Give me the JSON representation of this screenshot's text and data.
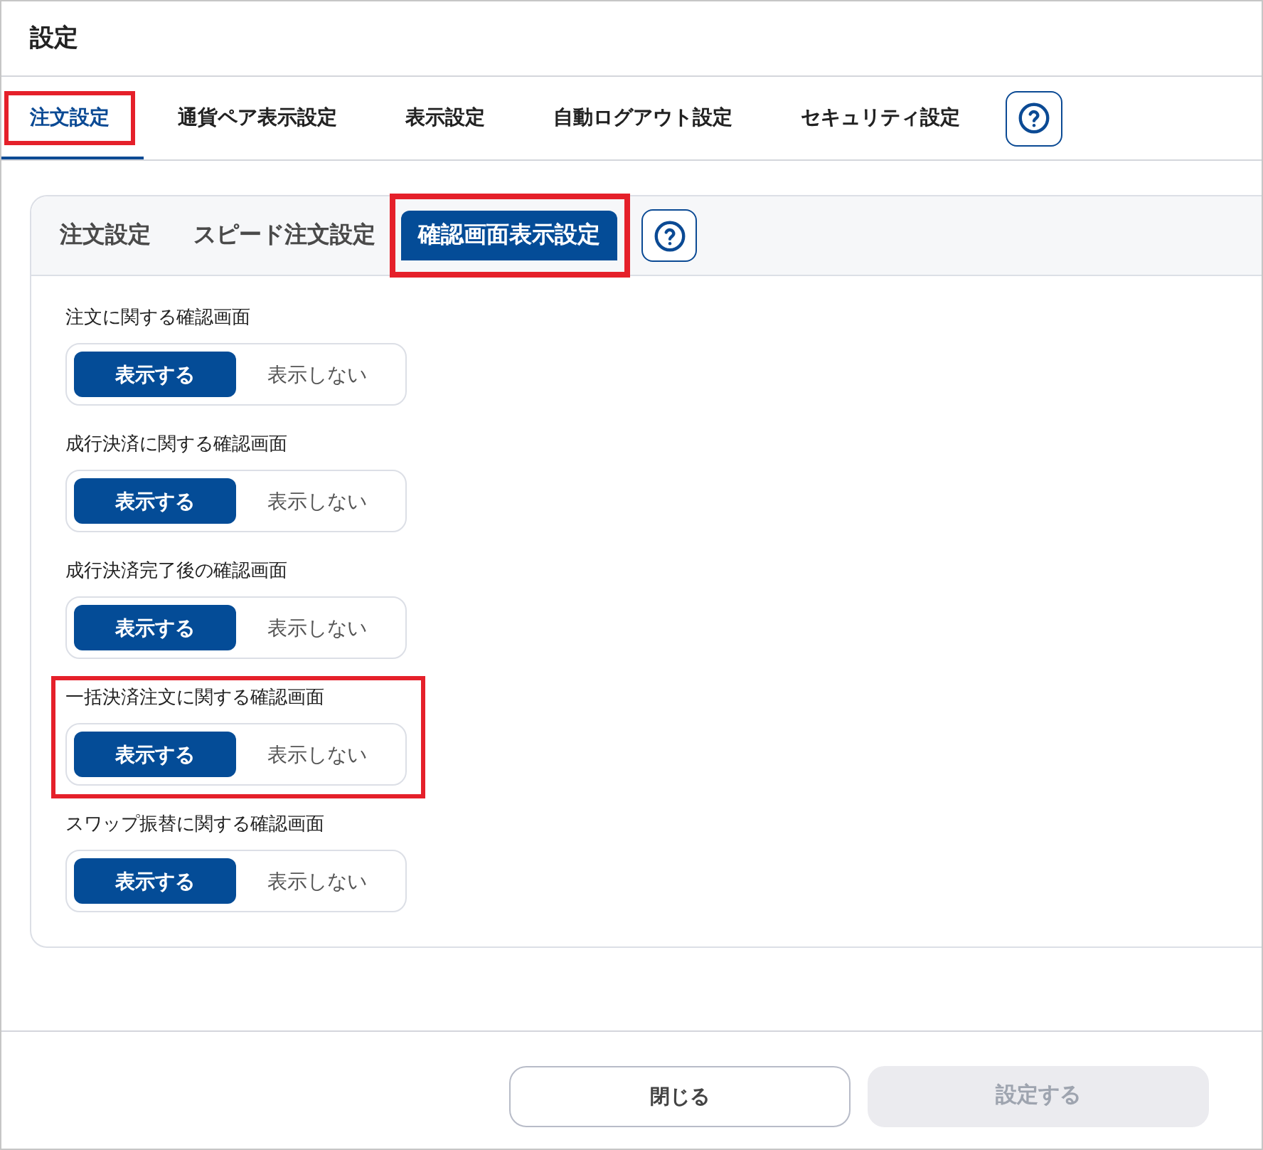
{
  "window": {
    "title": "設定"
  },
  "tabs": [
    {
      "label": "注文設定",
      "selected": true,
      "highlighted": true
    },
    {
      "label": "通貨ペア表示設定",
      "selected": false,
      "highlighted": false
    },
    {
      "label": "表示設定",
      "selected": false,
      "highlighted": false
    },
    {
      "label": "自動ログアウト設定",
      "selected": false,
      "highlighted": false
    },
    {
      "label": "セキュリティ設定",
      "selected": false,
      "highlighted": false
    }
  ],
  "sub_tabs": [
    {
      "label": "注文設定",
      "selected": false,
      "highlighted": false
    },
    {
      "label": "スピード注文設定",
      "selected": false,
      "highlighted": false
    },
    {
      "label": "確認画面表示設定",
      "selected": true,
      "highlighted": true
    }
  ],
  "settings": [
    {
      "label": "注文に関する確認画面",
      "highlighted": false,
      "options": [
        {
          "label": "表示する",
          "selected": true
        },
        {
          "label": "表示しない",
          "selected": false
        }
      ]
    },
    {
      "label": "成行決済に関する確認画面",
      "highlighted": false,
      "options": [
        {
          "label": "表示する",
          "selected": true
        },
        {
          "label": "表示しない",
          "selected": false
        }
      ]
    },
    {
      "label": "成行決済完了後の確認画面",
      "highlighted": false,
      "options": [
        {
          "label": "表示する",
          "selected": true
        },
        {
          "label": "表示しない",
          "selected": false
        }
      ]
    },
    {
      "label": "一括決済注文に関する確認画面",
      "highlighted": true,
      "options": [
        {
          "label": "表示する",
          "selected": true
        },
        {
          "label": "表示しない",
          "selected": false
        }
      ]
    },
    {
      "label": "スワップ振替に関する確認画面",
      "highlighted": false,
      "options": [
        {
          "label": "表示する",
          "selected": true
        },
        {
          "label": "表示しない",
          "selected": false
        }
      ]
    }
  ],
  "footer": {
    "buttons": [
      {
        "label": "閉じる",
        "kind": "secondary",
        "disabled": false
      },
      {
        "label": "設定する",
        "kind": "primary",
        "disabled": true
      }
    ]
  }
}
